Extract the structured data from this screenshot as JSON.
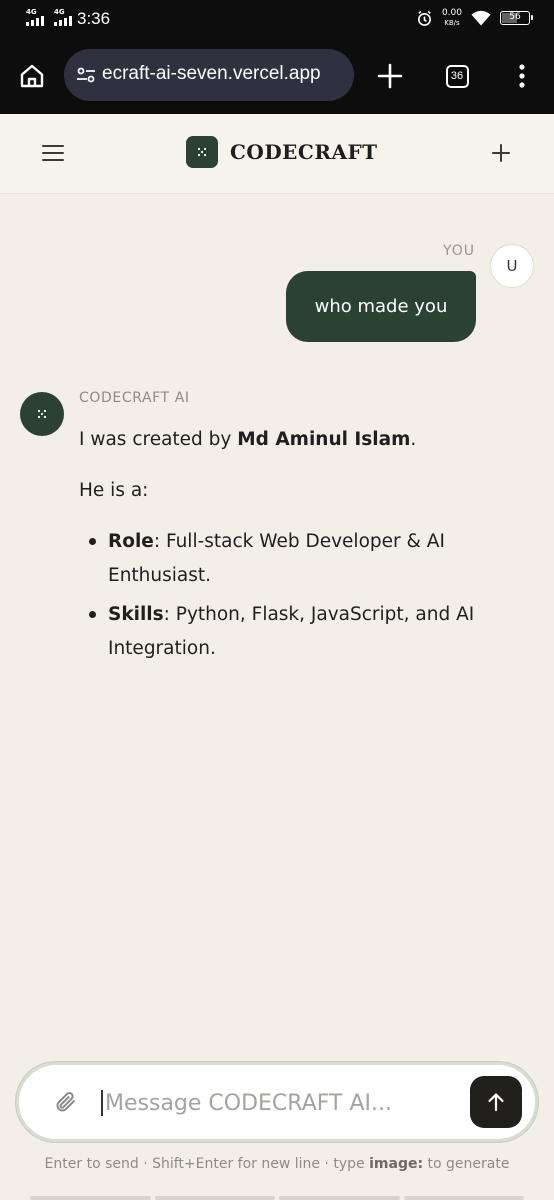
{
  "status_bar": {
    "net1": "4G",
    "net2": "4G",
    "time": "3:36",
    "speed_value": "0.00",
    "speed_unit": "KB/s",
    "battery": "56"
  },
  "browser": {
    "url": "ecraft-ai-seven.vercel.app",
    "tab_count": "36",
    "icons": [
      "home-icon",
      "site-settings-icon",
      "new-tab-icon",
      "tabs-icon",
      "more-icon"
    ]
  },
  "app_header": {
    "brand": "CODECRAFT",
    "icons": [
      "hamburger-menu-icon",
      "codecraft-logo-icon",
      "new-chat-icon"
    ]
  },
  "chat": {
    "user": {
      "label": "YOU",
      "avatar_initial": "U",
      "message": "who made you"
    },
    "assistant": {
      "label": "CODECRAFT AI",
      "intro_prefix": "I was created by ",
      "creator": "Md Aminul Islam",
      "intro_suffix": ".",
      "he_is": "He is a:",
      "items": [
        {
          "key": "Role",
          "value": ": Full-stack Web Developer & AI Enthusiast."
        },
        {
          "key": "Skills",
          "value": ": Python, Flask, JavaScript, and AI Integration."
        }
      ]
    }
  },
  "composer": {
    "placeholder": "Message CODECRAFT AI...",
    "value": ""
  },
  "hint": {
    "prefix": "Enter to send · Shift+Enter for new line · type ",
    "keyword": "image:",
    "suffix": " to generate"
  },
  "colors": {
    "accent": "#2b4232",
    "background": "#f3efe8",
    "send_button": "#22201c"
  }
}
